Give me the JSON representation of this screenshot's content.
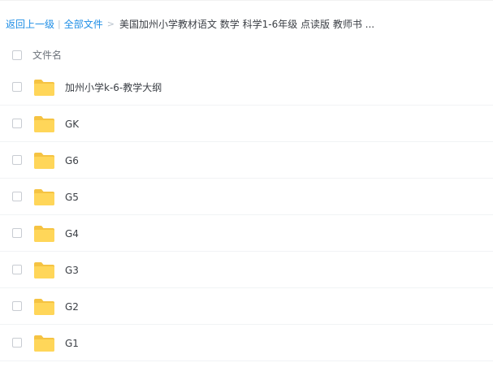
{
  "breadcrumb": {
    "back_label": "返回上一级",
    "separator": "|",
    "all_files_label": "全部文件",
    "arrow": ">",
    "current_path": "美国加州小学教材语文 数学 科学1-6年级 点读版 教师书 ..."
  },
  "table": {
    "header_label": "文件名"
  },
  "folders": [
    {
      "name": "加州小学k-6-教学大纲",
      "icon": "folder-icon"
    },
    {
      "name": "GK",
      "icon": "folder-icon"
    },
    {
      "name": "G6",
      "icon": "folder-icon"
    },
    {
      "name": "G5",
      "icon": "folder-icon"
    },
    {
      "name": "G4",
      "icon": "folder-icon"
    },
    {
      "name": "G3",
      "icon": "folder-icon"
    },
    {
      "name": "G2",
      "icon": "folder-icon"
    },
    {
      "name": "G1",
      "icon": "folder-icon"
    }
  ],
  "colors": {
    "link": "#1e8ee6",
    "folder": "#ffd659",
    "folder_tab": "#f5c342"
  }
}
